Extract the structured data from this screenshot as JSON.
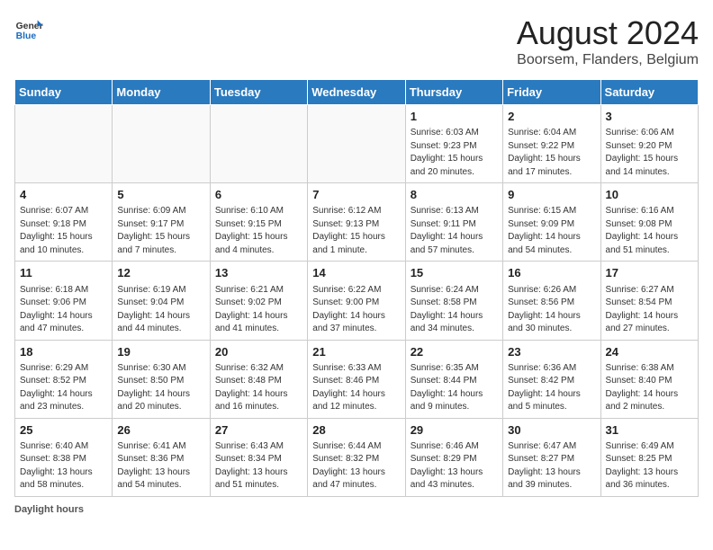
{
  "header": {
    "logo_general": "General",
    "logo_blue": "Blue",
    "title": "August 2024",
    "subtitle": "Boorsem, Flanders, Belgium"
  },
  "calendar": {
    "days_of_week": [
      "Sunday",
      "Monday",
      "Tuesday",
      "Wednesday",
      "Thursday",
      "Friday",
      "Saturday"
    ],
    "weeks": [
      [
        {
          "day": null,
          "info": null
        },
        {
          "day": null,
          "info": null
        },
        {
          "day": null,
          "info": null
        },
        {
          "day": null,
          "info": null
        },
        {
          "day": "1",
          "info": "Sunrise: 6:03 AM\nSunset: 9:23 PM\nDaylight: 15 hours and 20 minutes."
        },
        {
          "day": "2",
          "info": "Sunrise: 6:04 AM\nSunset: 9:22 PM\nDaylight: 15 hours and 17 minutes."
        },
        {
          "day": "3",
          "info": "Sunrise: 6:06 AM\nSunset: 9:20 PM\nDaylight: 15 hours and 14 minutes."
        }
      ],
      [
        {
          "day": "4",
          "info": "Sunrise: 6:07 AM\nSunset: 9:18 PM\nDaylight: 15 hours and 10 minutes."
        },
        {
          "day": "5",
          "info": "Sunrise: 6:09 AM\nSunset: 9:17 PM\nDaylight: 15 hours and 7 minutes."
        },
        {
          "day": "6",
          "info": "Sunrise: 6:10 AM\nSunset: 9:15 PM\nDaylight: 15 hours and 4 minutes."
        },
        {
          "day": "7",
          "info": "Sunrise: 6:12 AM\nSunset: 9:13 PM\nDaylight: 15 hours and 1 minute."
        },
        {
          "day": "8",
          "info": "Sunrise: 6:13 AM\nSunset: 9:11 PM\nDaylight: 14 hours and 57 minutes."
        },
        {
          "day": "9",
          "info": "Sunrise: 6:15 AM\nSunset: 9:09 PM\nDaylight: 14 hours and 54 minutes."
        },
        {
          "day": "10",
          "info": "Sunrise: 6:16 AM\nSunset: 9:08 PM\nDaylight: 14 hours and 51 minutes."
        }
      ],
      [
        {
          "day": "11",
          "info": "Sunrise: 6:18 AM\nSunset: 9:06 PM\nDaylight: 14 hours and 47 minutes."
        },
        {
          "day": "12",
          "info": "Sunrise: 6:19 AM\nSunset: 9:04 PM\nDaylight: 14 hours and 44 minutes."
        },
        {
          "day": "13",
          "info": "Sunrise: 6:21 AM\nSunset: 9:02 PM\nDaylight: 14 hours and 41 minutes."
        },
        {
          "day": "14",
          "info": "Sunrise: 6:22 AM\nSunset: 9:00 PM\nDaylight: 14 hours and 37 minutes."
        },
        {
          "day": "15",
          "info": "Sunrise: 6:24 AM\nSunset: 8:58 PM\nDaylight: 14 hours and 34 minutes."
        },
        {
          "day": "16",
          "info": "Sunrise: 6:26 AM\nSunset: 8:56 PM\nDaylight: 14 hours and 30 minutes."
        },
        {
          "day": "17",
          "info": "Sunrise: 6:27 AM\nSunset: 8:54 PM\nDaylight: 14 hours and 27 minutes."
        }
      ],
      [
        {
          "day": "18",
          "info": "Sunrise: 6:29 AM\nSunset: 8:52 PM\nDaylight: 14 hours and 23 minutes."
        },
        {
          "day": "19",
          "info": "Sunrise: 6:30 AM\nSunset: 8:50 PM\nDaylight: 14 hours and 20 minutes."
        },
        {
          "day": "20",
          "info": "Sunrise: 6:32 AM\nSunset: 8:48 PM\nDaylight: 14 hours and 16 minutes."
        },
        {
          "day": "21",
          "info": "Sunrise: 6:33 AM\nSunset: 8:46 PM\nDaylight: 14 hours and 12 minutes."
        },
        {
          "day": "22",
          "info": "Sunrise: 6:35 AM\nSunset: 8:44 PM\nDaylight: 14 hours and 9 minutes."
        },
        {
          "day": "23",
          "info": "Sunrise: 6:36 AM\nSunset: 8:42 PM\nDaylight: 14 hours and 5 minutes."
        },
        {
          "day": "24",
          "info": "Sunrise: 6:38 AM\nSunset: 8:40 PM\nDaylight: 14 hours and 2 minutes."
        }
      ],
      [
        {
          "day": "25",
          "info": "Sunrise: 6:40 AM\nSunset: 8:38 PM\nDaylight: 13 hours and 58 minutes."
        },
        {
          "day": "26",
          "info": "Sunrise: 6:41 AM\nSunset: 8:36 PM\nDaylight: 13 hours and 54 minutes."
        },
        {
          "day": "27",
          "info": "Sunrise: 6:43 AM\nSunset: 8:34 PM\nDaylight: 13 hours and 51 minutes."
        },
        {
          "day": "28",
          "info": "Sunrise: 6:44 AM\nSunset: 8:32 PM\nDaylight: 13 hours and 47 minutes."
        },
        {
          "day": "29",
          "info": "Sunrise: 6:46 AM\nSunset: 8:29 PM\nDaylight: 13 hours and 43 minutes."
        },
        {
          "day": "30",
          "info": "Sunrise: 6:47 AM\nSunset: 8:27 PM\nDaylight: 13 hours and 39 minutes."
        },
        {
          "day": "31",
          "info": "Sunrise: 6:49 AM\nSunset: 8:25 PM\nDaylight: 13 hours and 36 minutes."
        }
      ]
    ]
  },
  "footer": {
    "label": "Daylight hours"
  }
}
